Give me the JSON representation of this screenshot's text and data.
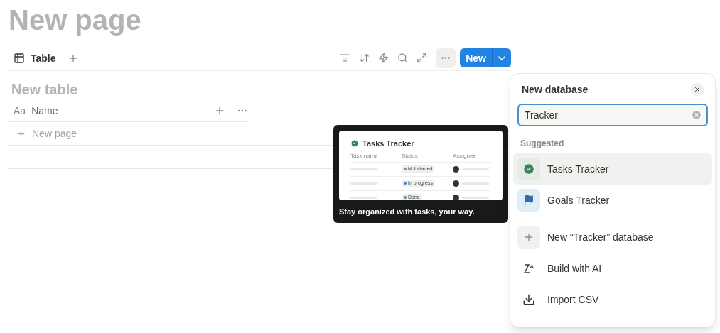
{
  "page": {
    "title": "New page"
  },
  "view_tabs": [
    {
      "label": "Table",
      "selected": true
    }
  ],
  "toolbar": {
    "new_button": "New"
  },
  "table": {
    "title": "New table",
    "column_type": "Aa",
    "column": "Name",
    "new_row": "New page"
  },
  "preview": {
    "title": "Tasks Tracker",
    "columns": [
      "Task name",
      "Status",
      "Assignee"
    ],
    "statuses": [
      {
        "label": "Not started",
        "color": "#8f8f8f"
      },
      {
        "label": "In progress",
        "color": "#3b82c4"
      },
      {
        "label": "Done",
        "color": "#4f9a6c"
      }
    ],
    "caption": "Stay organized with tasks, your way."
  },
  "menu": {
    "title": "New database",
    "search_value": "Tracker",
    "section": "Suggested",
    "items": [
      {
        "kind": "tasks",
        "label": "Tasks Tracker",
        "selected": true
      },
      {
        "kind": "goals",
        "label": "Goals Tracker",
        "selected": false
      },
      {
        "kind": "create",
        "label": "New “Tracker” database",
        "selected": false
      },
      {
        "kind": "ai",
        "label": "Build with AI",
        "selected": false
      },
      {
        "kind": "import",
        "label": "Import CSV",
        "selected": false
      }
    ]
  }
}
